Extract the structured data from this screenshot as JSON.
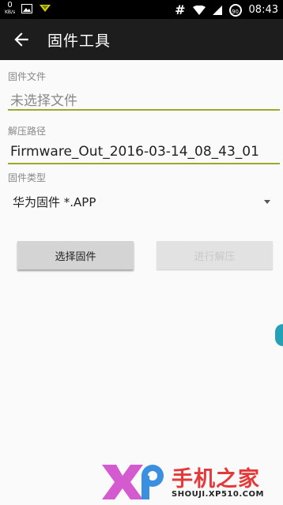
{
  "status_bar": {
    "net_speed_value": "0",
    "net_speed_unit": "KB/s",
    "battery_level": "90",
    "time": "08:43"
  },
  "app_bar": {
    "title": "固件工具"
  },
  "firmware_file": {
    "label": "固件文件",
    "placeholder": "未选择文件"
  },
  "extract_path": {
    "label": "解压路径",
    "value": "Firmware_Out_2016-03-14_08_43_01"
  },
  "firmware_type": {
    "label": "固件类型",
    "selected": "华为固件 *.APP"
  },
  "buttons": {
    "select": "选择固件",
    "extract": "进行解压"
  },
  "watermark": {
    "brand": "手机之家",
    "url": "SHOUJI.XP510.COM"
  },
  "colors": {
    "accent_underline": "#9ca82b",
    "toolbar_bg": "#1d1d1d",
    "watermark_red": "#e53838"
  }
}
